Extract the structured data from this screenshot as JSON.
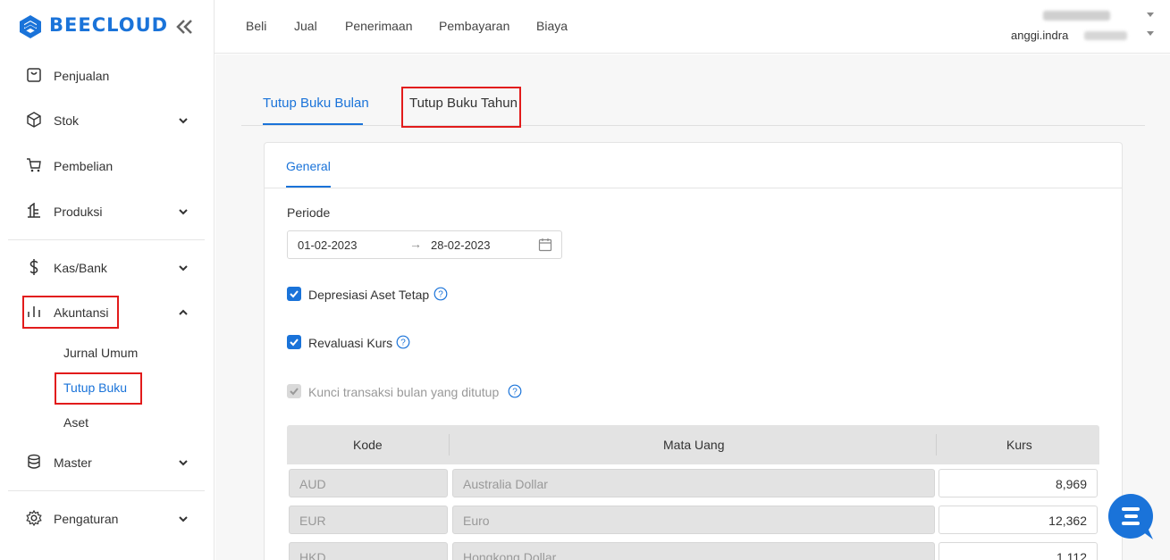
{
  "brand": {
    "name": "BEECLOUD",
    "color": "#1a73d9"
  },
  "sidebar": {
    "items": [
      {
        "label": "Penjualan",
        "icon": "receipt-icon"
      },
      {
        "label": "Stok",
        "icon": "box-icon"
      },
      {
        "label": "Pembelian",
        "icon": "cart-icon"
      },
      {
        "label": "Produksi",
        "icon": "factory-icon"
      },
      {
        "label": "Kas/Bank",
        "icon": "dollar-icon"
      },
      {
        "label": "Akuntansi",
        "icon": "bar-chart-icon"
      },
      {
        "label": "Master",
        "icon": "database-icon"
      },
      {
        "label": "Pengaturan",
        "icon": "gear-icon"
      }
    ],
    "akuntansi_sub": [
      "Jurnal Umum",
      "Tutup Buku",
      "Aset"
    ]
  },
  "topnav": {
    "menus": [
      "Beli",
      "Jual",
      "Penerimaan",
      "Pembayaran",
      "Biaya"
    ],
    "user_name": "anggi.indra"
  },
  "tabs": [
    "Tutup Buku Bulan",
    "Tutup Buku Tahun"
  ],
  "card": {
    "tab": "General",
    "periode_label": "Periode",
    "date_start": "01-02-2023",
    "date_end": "28-02-2023",
    "arrow": "→",
    "checkboxes": [
      {
        "label": "Depresiasi Aset Tetap",
        "checked": true,
        "disabled": false
      },
      {
        "label": "Revaluasi Kurs",
        "checked": true,
        "disabled": false
      },
      {
        "label": "Kunci transaksi bulan yang ditutup",
        "checked": true,
        "disabled": true
      }
    ],
    "table": {
      "headers": [
        "Kode",
        "Mata Uang",
        "Kurs"
      ],
      "rows": [
        {
          "kode": "AUD",
          "mata_uang": "Australia Dollar",
          "kurs": "8,969"
        },
        {
          "kode": "EUR",
          "mata_uang": "Euro",
          "kurs": "12,362"
        },
        {
          "kode": "HKD",
          "mata_uang": "Hongkong Dollar",
          "kurs": "1,112"
        }
      ]
    }
  },
  "colors": {
    "accent": "#1a73d9",
    "highlight": "#e21b1b"
  }
}
